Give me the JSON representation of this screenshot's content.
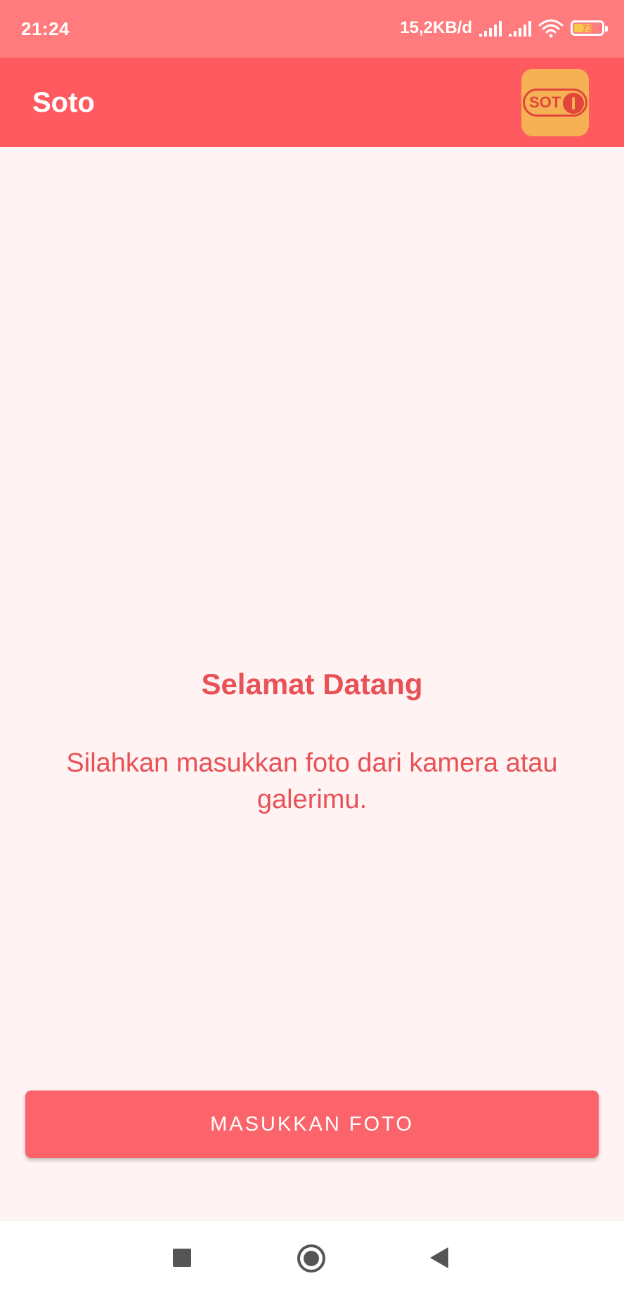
{
  "status_bar": {
    "time": "21:24",
    "net_speed": "15,2KB/d",
    "battery_level": "73",
    "icons": [
      "signal-icon",
      "signal-icon",
      "wifi-icon",
      "battery-icon"
    ]
  },
  "app_bar": {
    "title": "Soto",
    "logo_text": "SOT",
    "accent_color": "#ff5a5f"
  },
  "main": {
    "welcome_title": "Selamat Datang",
    "welcome_subtitle": "Silahkan masukkan foto dari kamera atau galerimu.",
    "background_color": "#fff4f3"
  },
  "button": {
    "label": "MASUKKAN FOTO",
    "color": "#fb646a"
  },
  "nav_bar": {
    "icons": [
      "recents-icon",
      "home-icon",
      "back-icon"
    ]
  }
}
